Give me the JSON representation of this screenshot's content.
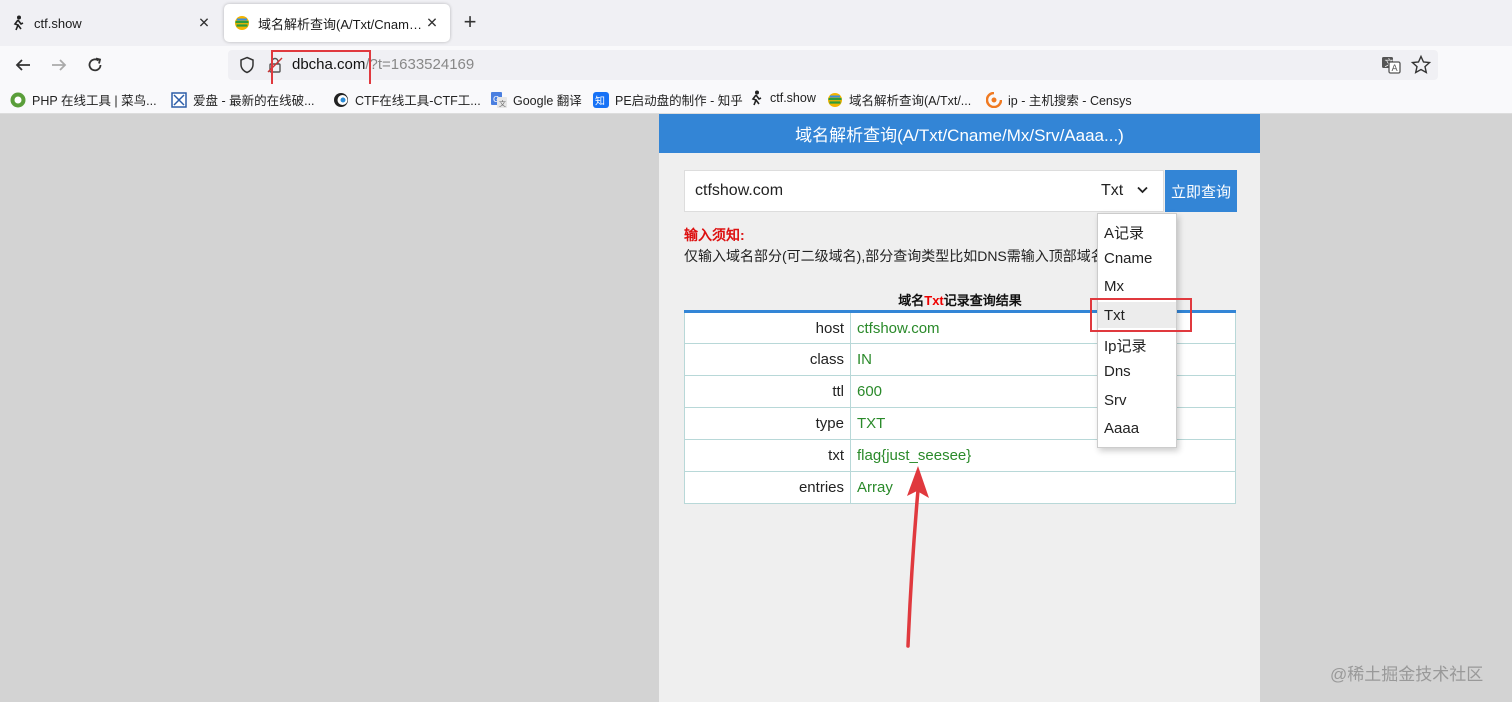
{
  "browser": {
    "tabs": [
      {
        "label": "ctf.show",
        "icon": "runner-icon"
      },
      {
        "label": "域名解析查询(A/Txt/Cname/Mx",
        "icon": "globe-icon",
        "active": true
      }
    ],
    "url": {
      "host": "dbcha.com",
      "rest": "/?t=1633524169"
    },
    "bookmarks": [
      {
        "label": "PHP 在线工具 | 菜鸟...",
        "icon": "runoob-icon"
      },
      {
        "label": "爱盘 - 最新的在线破...",
        "icon": "aipan-icon"
      },
      {
        "label": "CTF在线工具-CTF工...",
        "icon": "ctf-tool-icon"
      },
      {
        "label": "Google 翻译",
        "icon": "google-translate-icon"
      },
      {
        "label": "PE启动盘的制作 - 知乎",
        "icon": "zhihu-icon"
      },
      {
        "label": "ctf.show",
        "icon": "runner-icon"
      },
      {
        "label": "域名解析查询(A/Txt/...",
        "icon": "globe-icon"
      },
      {
        "label": "ip - 主机搜索 - Censys",
        "icon": "censys-icon"
      }
    ]
  },
  "page": {
    "header": "域名解析查询(A/Txt/Cname/Mx/Srv/Aaaa...)",
    "input_value": "ctfshow.com",
    "select_value": "Txt",
    "query_button": "立即查询",
    "notice_title": "输入须知:",
    "notice_text": "仅输入域名部分(可二级域名),部分查询类型比如DNS需输入顶部域名",
    "result_title_prefix": "域名",
    "result_title_type": "Txt",
    "result_title_suffix": "记录查询结果",
    "rows": [
      {
        "key": "host",
        "value": "ctfshow.com"
      },
      {
        "key": "class",
        "value": "IN"
      },
      {
        "key": "ttl",
        "value": "600"
      },
      {
        "key": "type",
        "value": "TXT"
      },
      {
        "key": "txt",
        "value": "flag{just_seesee}"
      },
      {
        "key": "entries",
        "value": "Array"
      }
    ],
    "dropdown_options": [
      "A记录",
      "Cname",
      "Mx",
      "Txt",
      "Ip记录",
      "Dns",
      "Srv",
      "Aaaa"
    ]
  },
  "watermark": "@稀土掘金技术社区",
  "colors": {
    "accent": "#3385d6",
    "annotation": "#e0393e",
    "value_green": "#2a8a2a"
  }
}
